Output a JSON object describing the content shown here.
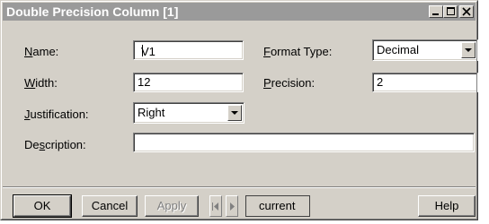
{
  "window": {
    "title": "Double Precision Column [1]",
    "controls": [
      "minimize-icon",
      "maximize-icon",
      "close-icon"
    ]
  },
  "form": {
    "name": {
      "label": "Name:",
      "mnemonic": "N",
      "rest": "ame:",
      "value": "V1"
    },
    "width": {
      "label": "Width:",
      "mnemonic": "W",
      "rest": "idth:",
      "value": "12"
    },
    "justification": {
      "label": "Justification:",
      "mnemonic": "J",
      "rest": "ustification:",
      "value": "Right"
    },
    "description": {
      "label": "Description:",
      "pre": "De",
      "mnemonic": "s",
      "rest": "cription:",
      "value": ""
    },
    "format_type": {
      "label": "Format Type:",
      "mnemonic": "F",
      "rest": "ormat Type:",
      "value": "Decimal"
    },
    "precision": {
      "label": "Precision:",
      "mnemonic": "P",
      "rest": "recision:",
      "value": "2"
    }
  },
  "buttons": {
    "ok": "OK",
    "cancel": "Cancel",
    "apply": "Apply",
    "help": "Help",
    "record": "current"
  },
  "colors": {
    "titlebar": "#9a9a9a",
    "face": "#d4d0c8",
    "disabled_text": "#808080"
  }
}
